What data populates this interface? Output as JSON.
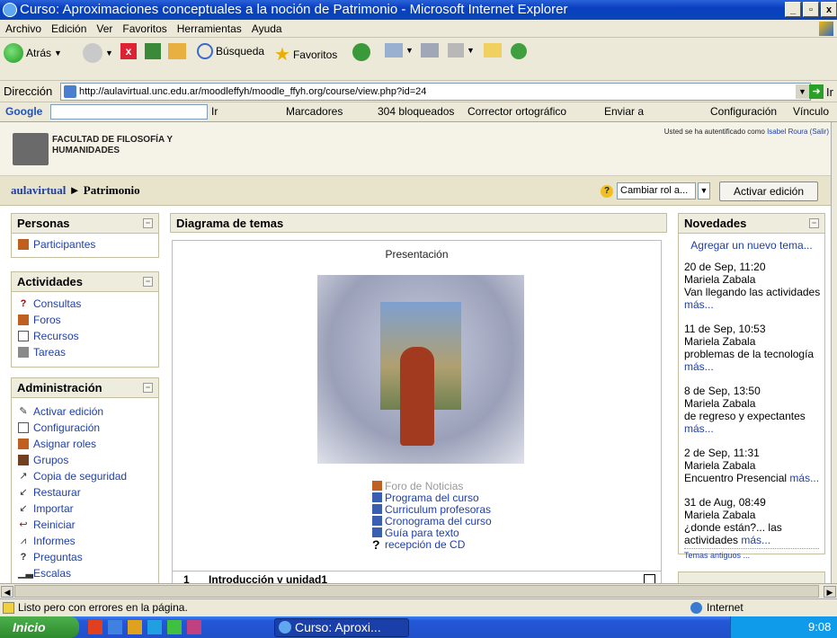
{
  "window": {
    "title": "Curso: Aproximaciones conceptuales a la noción de Patrimonio - Microsoft Internet Explorer"
  },
  "menu": [
    "Archivo",
    "Edición",
    "Ver",
    "Favoritos",
    "Herramientas",
    "Ayuda"
  ],
  "toolbar": {
    "back": "Atrás",
    "search": "Búsqueda",
    "favorites": "Favoritos"
  },
  "address": {
    "label": "Dirección",
    "url": "http://aulavirtual.unc.edu.ar/moodleffyh/moodle_ffyh.org/course/view.php?id=24",
    "go": "Ir"
  },
  "googlebar": {
    "brand": "Google",
    "ir": "Ir",
    "marcadores": "Marcadores",
    "bloqueados": "304 bloqueados",
    "corrector": "Corrector ortográfico",
    "enviar": "Enviar a",
    "config": "Configuración",
    "vinculos": "Vínculo"
  },
  "site": {
    "faculty_line1": "FACULTAD DE FILOSOFÍA Y",
    "faculty_line2": "HUMANIDADES",
    "auth_text": "Usted se ha autentificado como",
    "user": "Isabel Roura",
    "logout": "(Salir)"
  },
  "breadcrumb": {
    "home": "aulavirtual",
    "sep": "►",
    "current": "Patrimonio"
  },
  "role": {
    "label": "Cambiar rol a...",
    "edit_button": "Activar edición"
  },
  "personas": {
    "title": "Personas",
    "items": [
      "Participantes"
    ]
  },
  "actividades": {
    "title": "Actividades",
    "items": [
      "Consultas",
      "Foros",
      "Recursos",
      "Tareas"
    ]
  },
  "administracion": {
    "title": "Administración",
    "items": [
      "Activar edición",
      "Configuración",
      "Asignar roles",
      "Grupos",
      "Copia de seguridad",
      "Restaurar",
      "Importar",
      "Reiniciar",
      "Informes",
      "Preguntas",
      "Escalas"
    ]
  },
  "main": {
    "title": "Diagrama de temas",
    "presentation": "Presentación",
    "resources": [
      "Foro de Noticias",
      "Programa del curso",
      "Curriculum profesoras",
      "Cronograma del curso",
      "Guía para texto",
      "recepción de CD"
    ],
    "section_num": "1",
    "section_title": "Introducción y unidad1"
  },
  "novedades": {
    "title": "Novedades",
    "add": "Agregar un nuevo tema...",
    "items": [
      {
        "date": "20 de Sep, 11:20",
        "author": "Mariela Zabala",
        "text": "Van llegando las actividades",
        "more": "más..."
      },
      {
        "date": "11 de Sep, 10:53",
        "author": "Mariela Zabala",
        "text": "problemas de la tecnología",
        "more": "más..."
      },
      {
        "date": "8 de Sep, 13:50",
        "author": "Mariela Zabala",
        "text": "de regreso y expectantes",
        "more": "más..."
      },
      {
        "date": "2 de Sep, 11:31",
        "author": "Mariela Zabala",
        "text": "Encuentro Presencial",
        "more": "más..."
      },
      {
        "date": "31 de Aug, 08:49",
        "author": "Mariela Zabala",
        "text": "¿donde están?... las actividades",
        "more": "más..."
      }
    ],
    "older": "Temas antiguos ..."
  },
  "status": {
    "text": "Listo pero con errores en la página.",
    "zone": "Internet"
  },
  "taskbar": {
    "start": "Inicio",
    "task": "Curso: Aproxi...",
    "clock": "9:08"
  }
}
